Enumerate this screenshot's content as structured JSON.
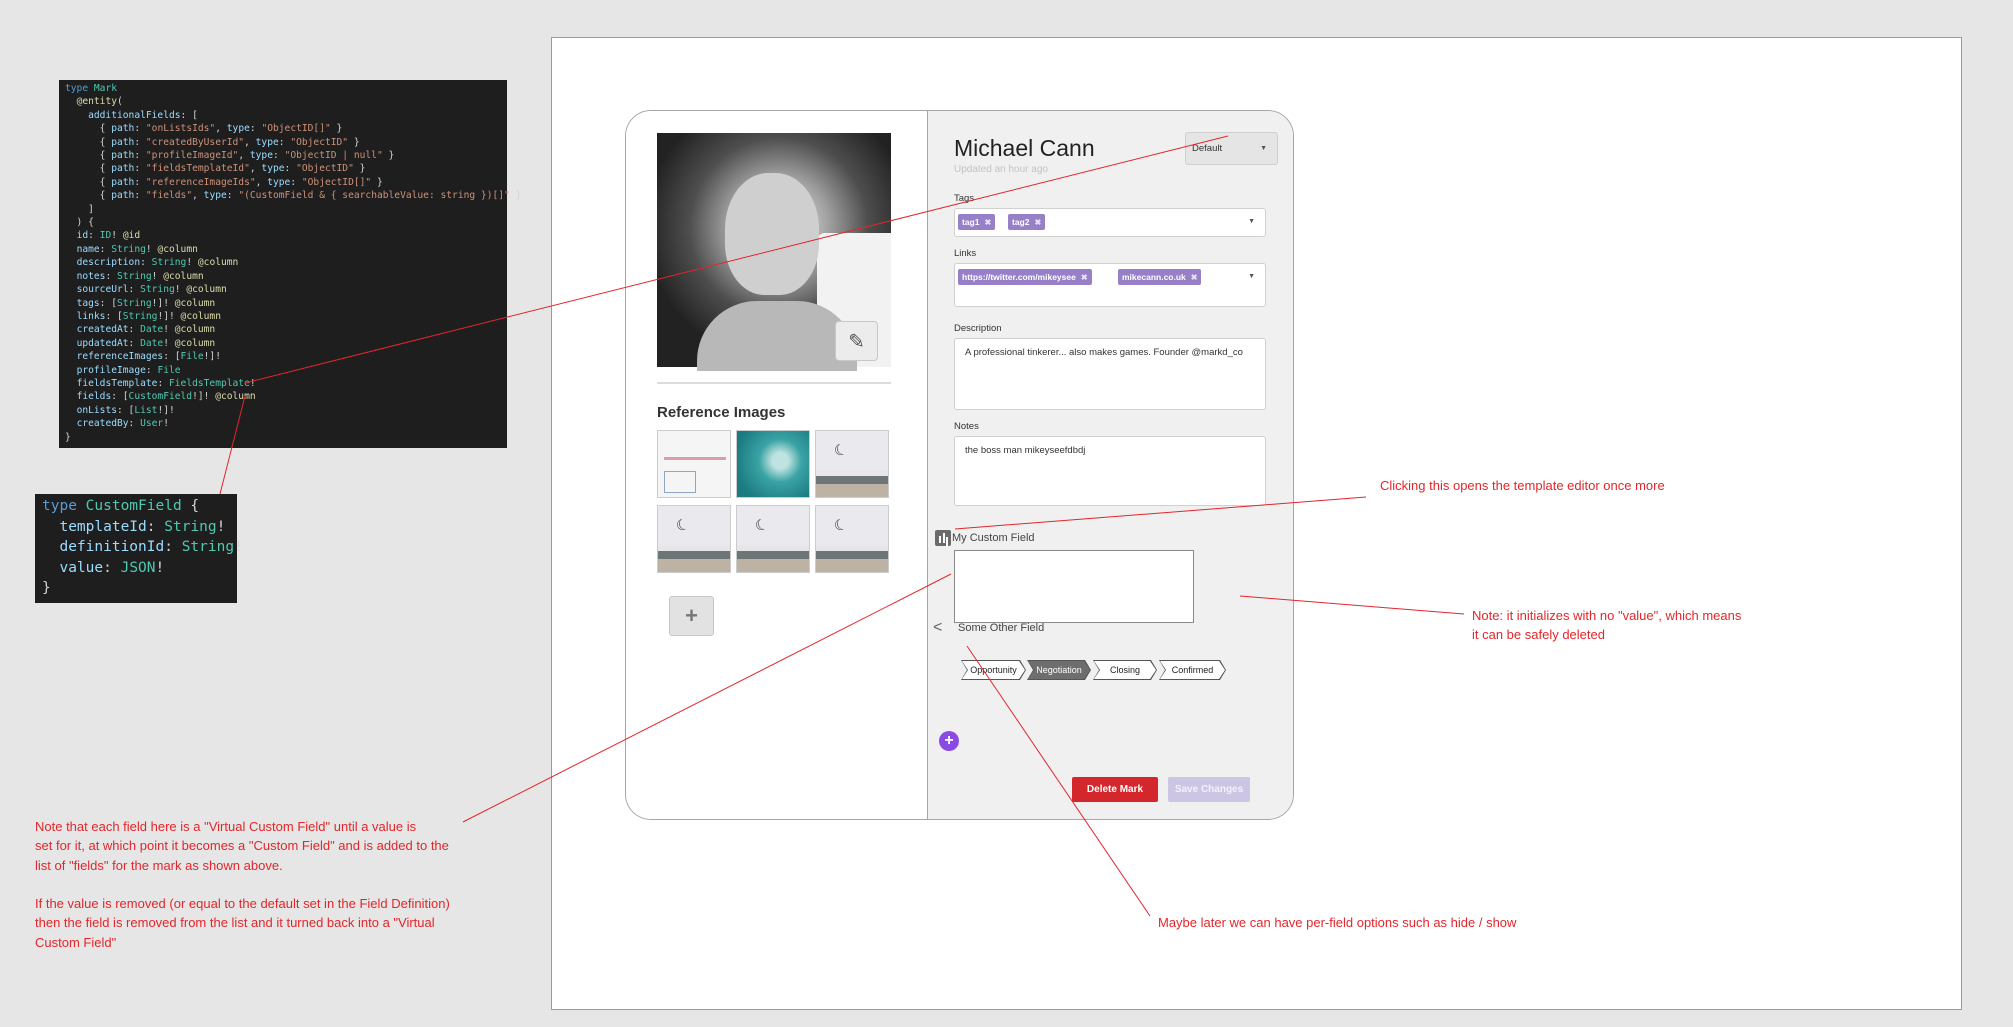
{
  "code_mark": {
    "lines": [
      [
        [
          "kw",
          "type "
        ],
        [
          "ty",
          "Mark"
        ]
      ],
      [
        [
          "pu",
          "  "
        ],
        [
          "fn",
          "@entity"
        ],
        [
          "pu",
          "("
        ]
      ],
      [
        [
          "pu",
          "    "
        ],
        [
          "pr",
          "additionalFields"
        ],
        [
          "pu",
          ": ["
        ]
      ],
      [
        [
          "pu",
          "      { "
        ],
        [
          "pr",
          "path"
        ],
        [
          "pu",
          ": "
        ],
        [
          "st",
          "\"onListsIds\""
        ],
        [
          "pu",
          ", "
        ],
        [
          "pr",
          "type"
        ],
        [
          "pu",
          ": "
        ],
        [
          "st",
          "\"ObjectID[]\""
        ],
        [
          "pu",
          " }"
        ]
      ],
      [
        [
          "pu",
          "      { "
        ],
        [
          "pr",
          "path"
        ],
        [
          "pu",
          ": "
        ],
        [
          "st",
          "\"createdByUserId\""
        ],
        [
          "pu",
          ", "
        ],
        [
          "pr",
          "type"
        ],
        [
          "pu",
          ": "
        ],
        [
          "st",
          "\"ObjectID\""
        ],
        [
          "pu",
          " }"
        ]
      ],
      [
        [
          "pu",
          "      { "
        ],
        [
          "pr",
          "path"
        ],
        [
          "pu",
          ": "
        ],
        [
          "st",
          "\"profileImageId\""
        ],
        [
          "pu",
          ", "
        ],
        [
          "pr",
          "type"
        ],
        [
          "pu",
          ": "
        ],
        [
          "st",
          "\"ObjectID | null\""
        ],
        [
          "pu",
          " }"
        ]
      ],
      [
        [
          "pu",
          "      { "
        ],
        [
          "pr",
          "path"
        ],
        [
          "pu",
          ": "
        ],
        [
          "st",
          "\"fieldsTemplateId\""
        ],
        [
          "pu",
          ", "
        ],
        [
          "pr",
          "type"
        ],
        [
          "pu",
          ": "
        ],
        [
          "st",
          "\"ObjectID\""
        ],
        [
          "pu",
          " }"
        ]
      ],
      [
        [
          "pu",
          "      { "
        ],
        [
          "pr",
          "path"
        ],
        [
          "pu",
          ": "
        ],
        [
          "st",
          "\"referenceImageIds\""
        ],
        [
          "pu",
          ", "
        ],
        [
          "pr",
          "type"
        ],
        [
          "pu",
          ": "
        ],
        [
          "st",
          "\"ObjectID[]\""
        ],
        [
          "pu",
          " }"
        ]
      ],
      [
        [
          "pu",
          "      { "
        ],
        [
          "pr",
          "path"
        ],
        [
          "pu",
          ": "
        ],
        [
          "st",
          "\"fields\""
        ],
        [
          "pu",
          ", "
        ],
        [
          "pr",
          "type"
        ],
        [
          "pu",
          ": "
        ],
        [
          "st",
          "\"(CustomField & { searchableValue: string })[]\""
        ],
        [
          "pu",
          " }"
        ]
      ],
      [
        [
          "pu",
          "    ]"
        ]
      ],
      [
        [
          "pu",
          "  ) {"
        ]
      ],
      [
        [
          "pu",
          "  "
        ],
        [
          "pr",
          "id"
        ],
        [
          "pu",
          ": "
        ],
        [
          "ty",
          "ID"
        ],
        [
          "pu",
          "! "
        ],
        [
          "fn",
          "@id"
        ]
      ],
      [
        [
          "pu",
          "  "
        ],
        [
          "pr",
          "name"
        ],
        [
          "pu",
          ": "
        ],
        [
          "ty",
          "String"
        ],
        [
          "pu",
          "! "
        ],
        [
          "fn",
          "@column"
        ]
      ],
      [
        [
          "pu",
          "  "
        ],
        [
          "pr",
          "description"
        ],
        [
          "pu",
          ": "
        ],
        [
          "ty",
          "String"
        ],
        [
          "pu",
          "! "
        ],
        [
          "fn",
          "@column"
        ]
      ],
      [
        [
          "pu",
          "  "
        ],
        [
          "pr",
          "notes"
        ],
        [
          "pu",
          ": "
        ],
        [
          "ty",
          "String"
        ],
        [
          "pu",
          "! "
        ],
        [
          "fn",
          "@column"
        ]
      ],
      [
        [
          "pu",
          "  "
        ],
        [
          "pr",
          "sourceUrl"
        ],
        [
          "pu",
          ": "
        ],
        [
          "ty",
          "String"
        ],
        [
          "pu",
          "! "
        ],
        [
          "fn",
          "@column"
        ]
      ],
      [
        [
          "pu",
          "  "
        ],
        [
          "pr",
          "tags"
        ],
        [
          "pu",
          ": ["
        ],
        [
          "ty",
          "String"
        ],
        [
          "pu",
          "!]! "
        ],
        [
          "fn",
          "@column"
        ]
      ],
      [
        [
          "pu",
          "  "
        ],
        [
          "pr",
          "links"
        ],
        [
          "pu",
          ": ["
        ],
        [
          "ty",
          "String"
        ],
        [
          "pu",
          "!]! "
        ],
        [
          "fn",
          "@column"
        ]
      ],
      [
        [
          "pu",
          "  "
        ],
        [
          "pr",
          "createdAt"
        ],
        [
          "pu",
          ": "
        ],
        [
          "ty",
          "Date"
        ],
        [
          "pu",
          "! "
        ],
        [
          "fn",
          "@column"
        ]
      ],
      [
        [
          "pu",
          "  "
        ],
        [
          "pr",
          "updatedAt"
        ],
        [
          "pu",
          ": "
        ],
        [
          "ty",
          "Date"
        ],
        [
          "pu",
          "! "
        ],
        [
          "fn",
          "@column"
        ]
      ],
      [
        [
          "pu",
          "  "
        ],
        [
          "pr",
          "referenceImages"
        ],
        [
          "pu",
          ": ["
        ],
        [
          "ty",
          "File"
        ],
        [
          "pu",
          "!]!"
        ]
      ],
      [
        [
          "pu",
          "  "
        ],
        [
          "pr",
          "profileImage"
        ],
        [
          "pu",
          ": "
        ],
        [
          "ty",
          "File"
        ]
      ],
      [
        [
          "pu",
          "  "
        ],
        [
          "pr",
          "fieldsTemplate"
        ],
        [
          "pu",
          ": "
        ],
        [
          "ty",
          "FieldsTemplate"
        ],
        [
          "pu",
          "!"
        ]
      ],
      [
        [
          "pu",
          "  "
        ],
        [
          "pr",
          "fields"
        ],
        [
          "pu",
          ": ["
        ],
        [
          "ty",
          "CustomField"
        ],
        [
          "pu",
          "!]! "
        ],
        [
          "fn",
          "@column"
        ]
      ],
      [
        [
          "pu",
          "  "
        ],
        [
          "pr",
          "onLists"
        ],
        [
          "pu",
          ": ["
        ],
        [
          "ty",
          "List"
        ],
        [
          "pu",
          "!]!"
        ]
      ],
      [
        [
          "pu",
          "  "
        ],
        [
          "pr",
          "createdBy"
        ],
        [
          "pu",
          ": "
        ],
        [
          "ty",
          "User"
        ],
        [
          "pu",
          "!"
        ]
      ],
      [
        [
          "pu",
          "}"
        ]
      ]
    ]
  },
  "code_customfield": {
    "lines": [
      [
        [
          "kw",
          "type "
        ],
        [
          "ty",
          "CustomField"
        ],
        [
          "pu",
          " {"
        ]
      ],
      [
        [
          "pu",
          "  "
        ],
        [
          "pr",
          "templateId"
        ],
        [
          "pu",
          ": "
        ],
        [
          "ty",
          "String"
        ],
        [
          "pu",
          "!"
        ]
      ],
      [
        [
          "pu",
          "  "
        ],
        [
          "pr",
          "definitionId"
        ],
        [
          "pu",
          ": "
        ],
        [
          "ty",
          "String"
        ],
        [
          "pu",
          "!"
        ]
      ],
      [
        [
          "pu",
          "  "
        ],
        [
          "pr",
          "value"
        ],
        [
          "pu",
          ": "
        ],
        [
          "ty",
          "JSON"
        ],
        [
          "pu",
          "!"
        ]
      ],
      [
        [
          "pu",
          "}"
        ]
      ]
    ]
  },
  "card": {
    "name": "Michael Cann",
    "updated": "Updated an hour ago",
    "template_select": "Default",
    "left": {
      "reference_heading": "Reference Images",
      "edit_icon": "edit-icon",
      "add_icon": "+",
      "thumbs": [
        "diagram",
        "ocean",
        "kite",
        "kite",
        "kite",
        "kite"
      ]
    },
    "tags": {
      "label": "Tags",
      "chips": [
        "tag1",
        "tag2"
      ]
    },
    "links": {
      "label": "Links",
      "chips": [
        "https://twitter.com/mikeysee",
        "mikecann.co.uk"
      ]
    },
    "description": {
      "label": "Description",
      "value": "A professional tinkerer... also makes games. Founder @markd_co"
    },
    "notes": {
      "label": "Notes",
      "value": "the boss man mikeyseefdbdj"
    },
    "custom_field": {
      "label": "My Custom Field",
      "value": ""
    },
    "other_field": {
      "label": "Some Other Field",
      "steps": [
        "Opportunity",
        "Negotiation",
        "Closing",
        "Confirmed"
      ],
      "active_step": "Negotiation"
    },
    "add_field_label": "+",
    "delete_label": "Delete Mark",
    "save_label": "Save Changes"
  },
  "notes": {
    "template_editor": "Clicking this opens the template editor once more",
    "no_value": "Note: it initializes with no \"value\", which means\nit can be safely deleted",
    "virtual_field": "Note that each field here is a \"Virtual Custom Field\" until a value is\nset for it, at which point it becomes a \"Custom Field\" and is added to the\nlist of \"fields\" for the mark as shown above.\n\nIf the value is removed (or equal to the default set in the Field Definition)\nthen the field is removed from the list and it turned back into a \"Virtual\nCustom Field\"",
    "per_field": "Maybe later we can have per-field options such as hide / show"
  },
  "colors": {
    "annotation": "#e3262b",
    "chip": "#9880c9",
    "delete": "#d3272c",
    "add_field": "#8a4be2"
  }
}
